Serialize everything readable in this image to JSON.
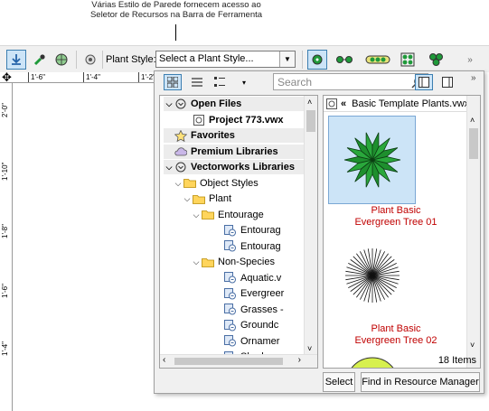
{
  "callout": {
    "line1": "Várias Estilo de Parede fornecem acesso ao",
    "line2": "Seletor de Recursos na Barra de Ferramenta"
  },
  "toolbar": {
    "plant_style_label": "Plant Style:",
    "plant_style_value": "Select a Plant Style..."
  },
  "ruler": {
    "h_ticks": [
      "1'-6\"",
      "1'-4\"",
      "1'-2\""
    ],
    "v_ticks": [
      "2'-0\"",
      "1'-10\"",
      "1'-8\"",
      "1'-6\"",
      "1'-4\""
    ]
  },
  "panel": {
    "search_placeholder": "Search",
    "tree": [
      {
        "label": "Open Files",
        "bold": true,
        "toggle": "˅",
        "icon": "open-files-icon"
      },
      {
        "label": "Project 773.vwx",
        "bold": true,
        "toggle": "",
        "icon": "vectorworks-file-icon"
      },
      {
        "label": "Favorites",
        "bold": true,
        "toggle": "",
        "icon": "star-icon"
      },
      {
        "label": "Premium Libraries",
        "bold": true,
        "toggle": "",
        "icon": "cloud-icon"
      },
      {
        "label": "Vectorworks Libraries",
        "bold": true,
        "toggle": "˅",
        "icon": "vectorworks-libraries-icon"
      },
      {
        "label": "Object Styles",
        "bold": false,
        "toggle": "˅",
        "icon": "folder-icon"
      },
      {
        "label": "Plant",
        "bold": false,
        "toggle": "˅",
        "icon": "folder-icon"
      },
      {
        "label": "Entourage",
        "bold": false,
        "toggle": "˅",
        "icon": "folder-icon"
      },
      {
        "label": "Entourag",
        "bold": false,
        "toggle": "",
        "icon": "resource-file-icon"
      },
      {
        "label": "Entourag",
        "bold": false,
        "toggle": "",
        "icon": "resource-file-icon"
      },
      {
        "label": "Non-Species",
        "bold": false,
        "toggle": "˅",
        "icon": "folder-icon"
      },
      {
        "label": "Aquatic.v",
        "bold": false,
        "toggle": "",
        "icon": "resource-file-icon"
      },
      {
        "label": "Evergreer",
        "bold": false,
        "toggle": "",
        "icon": "resource-file-icon"
      },
      {
        "label": "Grasses -",
        "bold": false,
        "toggle": "",
        "icon": "resource-file-icon"
      },
      {
        "label": "Groundc",
        "bold": false,
        "toggle": "",
        "icon": "resource-file-icon"
      },
      {
        "label": "Ornamer",
        "bold": false,
        "toggle": "",
        "icon": "resource-file-icon"
      },
      {
        "label": "Shadesc",
        "bold": false,
        "toggle": "",
        "icon": "resource-file-icon"
      }
    ],
    "resources_header": "Basic Template Plants.vwx",
    "resources": [
      {
        "line1": "Plant Basic",
        "line2": "Evergreen Tree 01"
      },
      {
        "line1": "Plant Basic",
        "line2": "Evergreen Tree 02"
      }
    ],
    "item_count": "18 Items",
    "select_button": "Select",
    "find_button": "Find in Resource Manager"
  }
}
